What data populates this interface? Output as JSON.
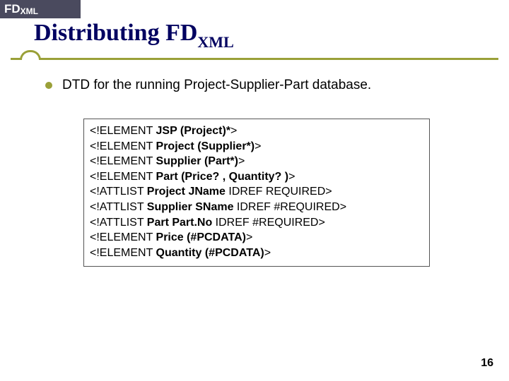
{
  "header": {
    "label_main": "FD",
    "label_sub": "XML"
  },
  "title": {
    "main": "Distributing FD",
    "sub": "XML"
  },
  "bullet": {
    "text": "DTD for the running Project-Supplier-Part database."
  },
  "dtd": {
    "lines": [
      {
        "pre": "<!ELEMENT ",
        "bold": "JSP (Project)*",
        "post": ">"
      },
      {
        "pre": "<!ELEMENT ",
        "bold": "Project (Supplier*)",
        "post": ">"
      },
      {
        "pre": "<!ELEMENT ",
        "bold": "Supplier (Part*)",
        "post": ">"
      },
      {
        "pre": "<!ELEMENT ",
        "bold": "Part (Price? , Quantity? )",
        "post": ">"
      },
      {
        "pre": "<!ATTLIST ",
        "bold": "Project JName",
        "post": " IDREF REQUIRED>"
      },
      {
        "pre": "<!ATTLIST ",
        "bold": "Supplier SName",
        "post": " IDREF #REQUIRED>"
      },
      {
        "pre": "<!ATTLIST ",
        "bold": "Part Part.No",
        "post": " IDREF #REQUIRED>"
      },
      {
        "pre": "<!ELEMENT ",
        "bold": "Price (#PCDATA)",
        "post": ">"
      },
      {
        "pre": "<!ELEMENT ",
        "bold": "Quantity (#PCDATA)",
        "post": ">"
      }
    ]
  },
  "page_number": "16"
}
